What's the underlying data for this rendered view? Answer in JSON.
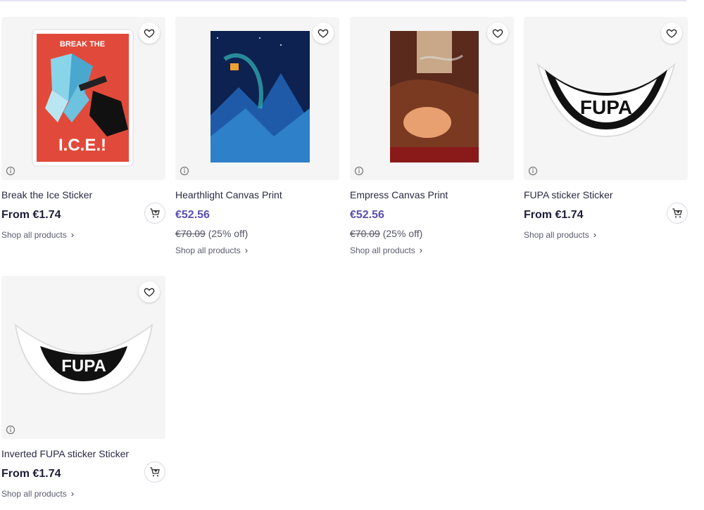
{
  "products": [
    {
      "title": "Break the Ice Sticker",
      "price": "From €1.74",
      "shop_label": "Shop all products",
      "art_text_top": "BREAK THE",
      "art_text_bottom": "I.C.E.!"
    },
    {
      "title": "Hearthlight Canvas Print",
      "price": "€52.56",
      "was_price": "€70.09",
      "discount": "(25% off)",
      "shop_label": "Shop all products"
    },
    {
      "title": "Empress Canvas Print",
      "price": "€52.56",
      "was_price": "€70.09",
      "discount": "(25% off)",
      "shop_label": "Shop all products"
    },
    {
      "title": "FUPA sticker Sticker",
      "price": "From €1.74",
      "shop_label": "Shop all products",
      "art_text": "FUPA"
    },
    {
      "title": "Inverted FUPA sticker Sticker",
      "price": "From €1.74",
      "shop_label": "Shop all products",
      "art_text": "FUPA"
    }
  ],
  "colors": {
    "sale_price": "#5b4fb0",
    "thumb_bg": "#f5f5f5"
  }
}
